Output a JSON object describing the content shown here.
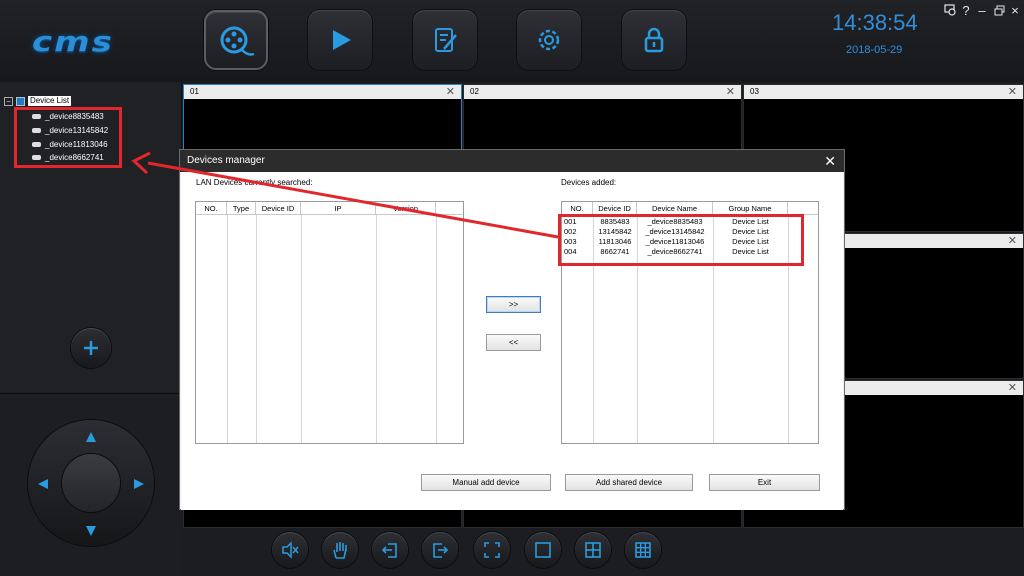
{
  "app": {
    "logo": "cms"
  },
  "nav": [
    {
      "name": "playback-icon",
      "active": true
    },
    {
      "name": "play-icon",
      "active": false
    },
    {
      "name": "edit-log-icon",
      "active": false
    },
    {
      "name": "settings-icon",
      "active": false
    },
    {
      "name": "lock-icon",
      "active": false
    }
  ],
  "clock": {
    "time": "14:38:54",
    "date": "2018-05-29"
  },
  "window_controls": {
    "help": "?",
    "minimize": "–",
    "close": "×"
  },
  "tree": {
    "root_label": "Device List",
    "devices": [
      "_device8835483",
      "_device13145842",
      "_device11813046",
      "_device8662741"
    ]
  },
  "channels": {
    "c01": "01",
    "c02": "02",
    "c03": "03",
    "close_glyph": "✕"
  },
  "dialog": {
    "title": "Devices manager",
    "close_glyph": "✕",
    "lan_label": "LAN Devices currently searched:",
    "added_label": "Devices added:",
    "lan_columns": [
      "NO.",
      "Type",
      "Device ID",
      "IP",
      "Version"
    ],
    "added_columns": [
      "NO.",
      "Device ID",
      "Device Name",
      "Group Name"
    ],
    "added_rows": [
      [
        "001",
        "8835483",
        "_device8835483",
        "Device List"
      ],
      [
        "002",
        "13145842",
        "_device13145842",
        "Device List"
      ],
      [
        "003",
        "11813046",
        "_device11813046",
        "Device List"
      ],
      [
        "004",
        "8662741",
        "_device8662741",
        "Device List"
      ]
    ],
    "add_arrow": ">>",
    "remove_arrow": "<<",
    "manual_add": "Manual add device",
    "add_shared": "Add shared device",
    "exit": "Exit"
  },
  "toolbar": [
    "mute-icon",
    "hand-icon",
    "exit-left-icon",
    "exit-right-icon",
    "fullscreen-icon",
    "layout-1-icon",
    "layout-4-icon",
    "layout-9-icon"
  ],
  "colors": {
    "accent": "#2a8fd6",
    "annotation": "#e2262b"
  }
}
